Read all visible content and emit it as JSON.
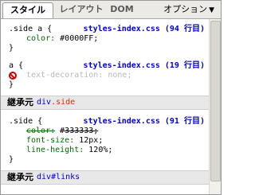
{
  "tabs": [
    {
      "label": "スタイル",
      "active": true
    },
    {
      "label": "レイアウト",
      "active": false
    },
    {
      "label": "DOM",
      "active": false
    }
  ],
  "options_label": "オプション",
  "rules": [
    {
      "selector": ".side a {",
      "source": "styles-index.css (94 行目)",
      "properties": [
        {
          "name": "color:",
          "value": "#0000FF;",
          "overridden": false,
          "disabled": false
        }
      ],
      "close": "}"
    },
    {
      "selector": "a {",
      "source": "styles-index.css (19 行目)",
      "properties": [
        {
          "name": "text-decoration:",
          "value": "none;",
          "overridden": false,
          "disabled": true
        }
      ],
      "close": "}"
    }
  ],
  "inherited_1": {
    "label": "継承元",
    "tag": "div",
    "cls": ".side"
  },
  "rules_inherited": [
    {
      "selector": ".side {",
      "source": "styles-index.css (91 行目)",
      "properties": [
        {
          "name": "color:",
          "value": "#333333;",
          "overridden": true,
          "disabled": false
        },
        {
          "name": "font-size:",
          "value": "12px;",
          "overridden": false,
          "disabled": false
        },
        {
          "name": "line-height:",
          "value": "120%;",
          "overridden": false,
          "disabled": false
        }
      ],
      "close": "}"
    }
  ],
  "inherited_2": {
    "label": "継承元",
    "tag": "div",
    "id": "#links"
  },
  "colors": {
    "selector_source": "#0000cc",
    "prop_name": "#006600",
    "disabled_icon": "#cc0000"
  }
}
